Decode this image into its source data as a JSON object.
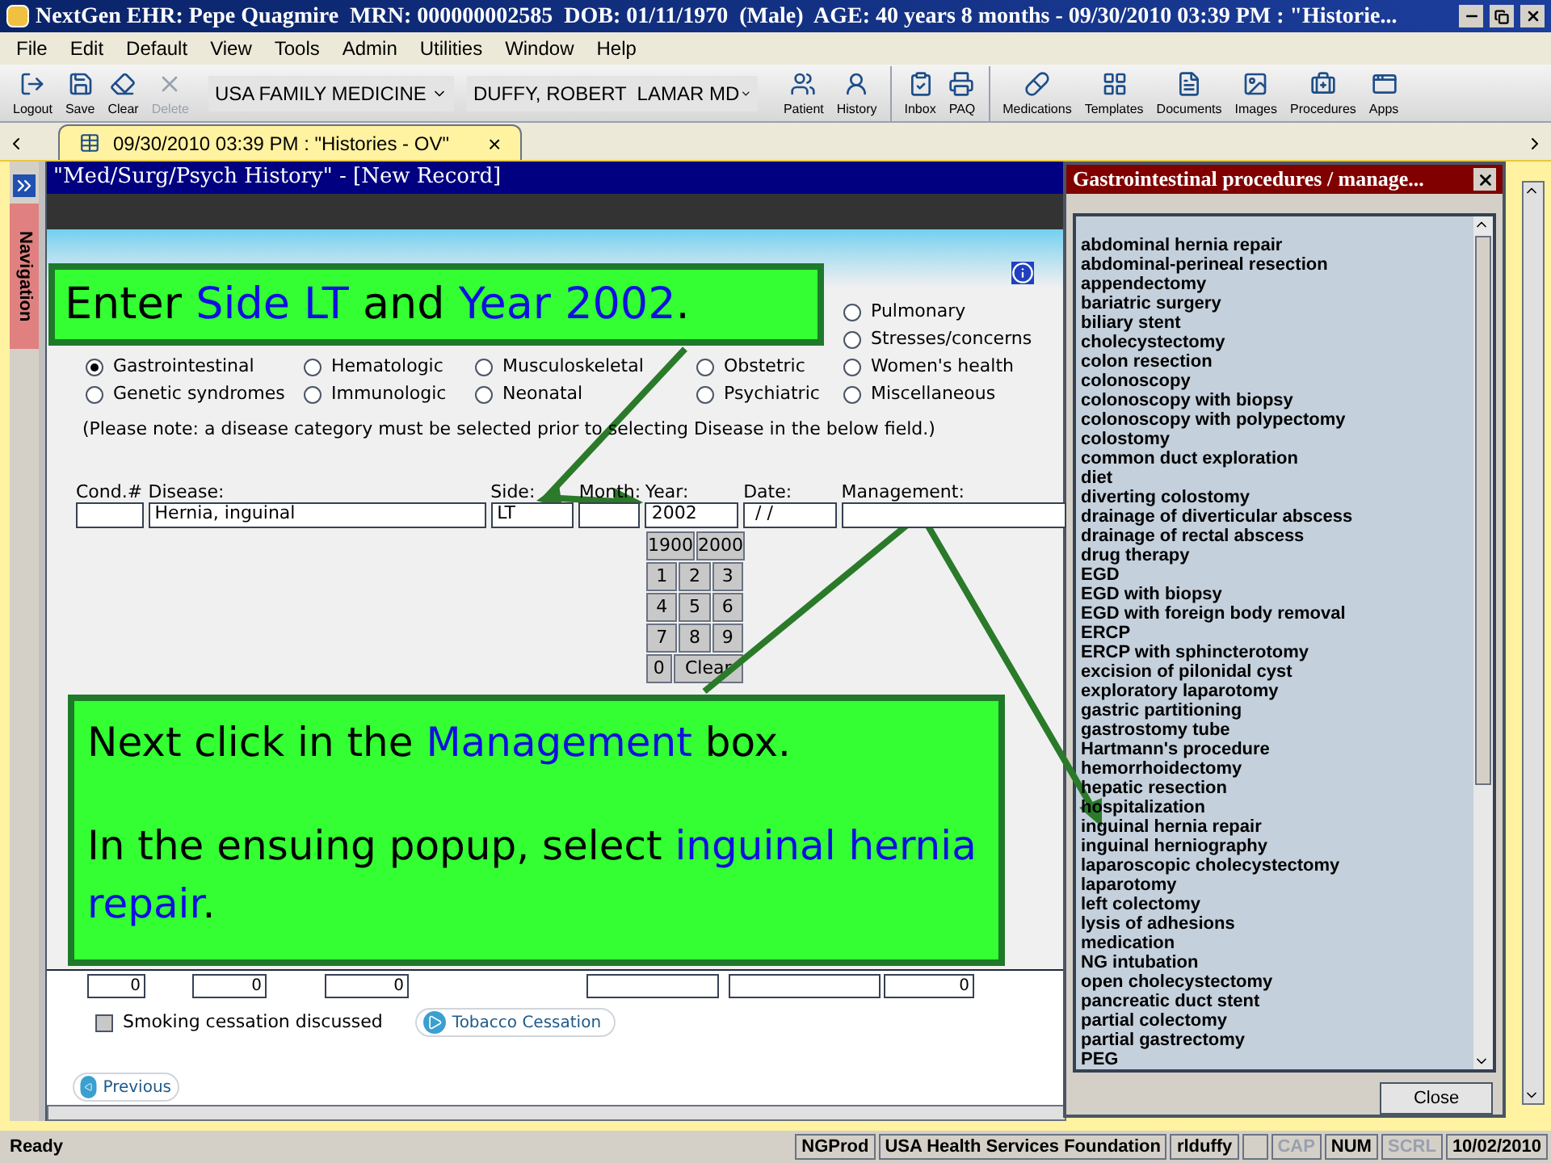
{
  "window": {
    "title": "NextGen EHR: Pepe Quagmire  MRN: 000000002585  DOB: 01/11/1970  (Male)  AGE: 40 years 8 months - 09/30/2010 03:39 PM : \"Historie..."
  },
  "menu": [
    "File",
    "Edit",
    "Default",
    "View",
    "Tools",
    "Admin",
    "Utilities",
    "Window",
    "Help"
  ],
  "toolbar_left": [
    {
      "label": "Logout",
      "disabled": false
    },
    {
      "label": "Save",
      "disabled": false
    },
    {
      "label": "Clear",
      "disabled": false
    },
    {
      "label": "Delete",
      "disabled": true
    }
  ],
  "dropdowns": [
    {
      "value": "USA FAMILY MEDICINE"
    },
    {
      "value": "DUFFY, ROBERT  LAMAR MD"
    }
  ],
  "toolbar_right": [
    {
      "label": "Patient"
    },
    {
      "label": "History"
    },
    {
      "label": "Inbox"
    },
    {
      "label": "PAQ"
    },
    {
      "label": "Medications"
    },
    {
      "label": "Templates"
    },
    {
      "label": "Documents"
    },
    {
      "label": "Images"
    },
    {
      "label": "Procedures"
    },
    {
      "label": "Apps"
    }
  ],
  "tabs": [
    {
      "label": "09/30/2010 03:39 PM : \"Histories - OV\"",
      "selected": true,
      "close": "×"
    }
  ],
  "navigation": {
    "label": "Navigation"
  },
  "form": {
    "title": "\"Med/Surg/Psych History\" - [New Record]",
    "categories": [
      [
        {
          "label": "Pulmonary",
          "selected": false
        }
      ],
      [
        {
          "label": "Stresses/concerns",
          "selected": false
        }
      ],
      [
        {
          "label": "Gastrointestinal",
          "selected": true
        },
        {
          "label": "Hematologic",
          "selected": false
        },
        {
          "label": "Musculoskeletal",
          "selected": false
        },
        {
          "label": "Obstetric",
          "selected": false
        },
        {
          "label": "Women's health",
          "selected": false
        }
      ],
      [
        {
          "label": "Genetic syndromes",
          "selected": false
        },
        {
          "label": "Immunologic",
          "selected": false
        },
        {
          "label": "Neonatal",
          "selected": false
        },
        {
          "label": "Psychiatric",
          "selected": false
        },
        {
          "label": "Miscellaneous",
          "selected": false
        }
      ]
    ],
    "note": "(Please note: a disease category must be selected prior to selecting Disease in the below field.)",
    "fields": [
      {
        "label": "Cond.#"
      },
      {
        "label": "Disease:",
        "value": "Hernia, inguinal"
      },
      {
        "label": "Side:",
        "value": "LT"
      },
      {
        "label": "Month:"
      },
      {
        "label": "Year:",
        "value": "2002"
      },
      {
        "label": "Date:",
        "value": " / /"
      },
      {
        "label": "Management:"
      }
    ],
    "keypad": [
      [
        "1900",
        "2000"
      ],
      [
        "1",
        "2",
        "3"
      ],
      [
        "4",
        "5",
        "6"
      ],
      [
        "7",
        "8",
        "9"
      ],
      [
        "0",
        "Clear"
      ]
    ],
    "bottom_inputs": [
      {
        "value": "0"
      },
      {
        "value": "0"
      },
      {
        "value": "0"
      },
      {
        "value": "0"
      }
    ],
    "smoking": {
      "label": "Smoking cessation discussed",
      "checked": false
    },
    "tobacco_button": "Tobacco Cessation",
    "previous_button": "Previous"
  },
  "popup": {
    "title": "Gastrointestinal procedures / manage...",
    "close_button": "Close",
    "items": [
      "abdominal hernia repair",
      "abdominal-perineal resection",
      "appendectomy",
      "bariatric surgery",
      "biliary stent",
      "cholecystectomy",
      "colon resection",
      "colonoscopy",
      "colonoscopy with biopsy",
      "colonoscopy with polypectomy",
      "colostomy",
      "common duct exploration",
      "diet",
      "diverting colostomy",
      "drainage of diverticular abscess",
      "drainage of rectal abscess",
      "drug therapy",
      "EGD",
      "EGD with biopsy",
      "EGD with foreign body removal",
      "ERCP",
      "ERCP with sphincterotomy",
      "excision of pilonidal cyst",
      "exploratory laparotomy",
      "gastric partitioning",
      "gastrostomy tube",
      "Hartmann's procedure",
      "hemorrhoidectomy",
      "hepatic resection",
      "hospitalization",
      "inguinal hernia repair",
      "inguinal herniography",
      "laparoscopic cholecystectomy",
      "laparotomy",
      "left colectomy",
      "lysis of adhesions",
      "medication",
      "NG intubation",
      "open cholecystectomy",
      "pancreatic duct stent",
      "partial colectomy",
      "partial gastrectomy",
      "PEG"
    ]
  },
  "callouts": [
    {
      "paragraphs": [
        [
          {
            "text": "Enter ",
            "highlight": false
          },
          {
            "text": "Side LT",
            "highlight": true
          },
          {
            "text": " and ",
            "highlight": false
          },
          {
            "text": "Year 2002",
            "highlight": true
          },
          {
            "text": ".",
            "highlight": false
          }
        ]
      ]
    },
    {
      "paragraphs": [
        [
          {
            "text": "Next click in the ",
            "highlight": false
          },
          {
            "text": "Management",
            "highlight": true
          },
          {
            "text": " box.",
            "highlight": false
          }
        ],
        [
          {
            "text": "In the ensuing popup, select ",
            "highlight": false
          },
          {
            "text": "inguinal hernia repair",
            "highlight": true
          },
          {
            "text": ".",
            "highlight": false
          }
        ]
      ]
    }
  ],
  "status_bar": [
    {
      "text": "Ready",
      "disabled": false
    },
    {
      "text": "NGProd",
      "disabled": false
    },
    {
      "text": "USA Health Services Foundation",
      "disabled": false
    },
    {
      "text": "rlduffy",
      "disabled": false
    },
    {
      "text": "CAP",
      "disabled": true
    },
    {
      "text": "NUM",
      "disabled": false
    },
    {
      "text": "SCRL",
      "disabled": true
    },
    {
      "text": "10/02/2010",
      "disabled": false
    }
  ]
}
